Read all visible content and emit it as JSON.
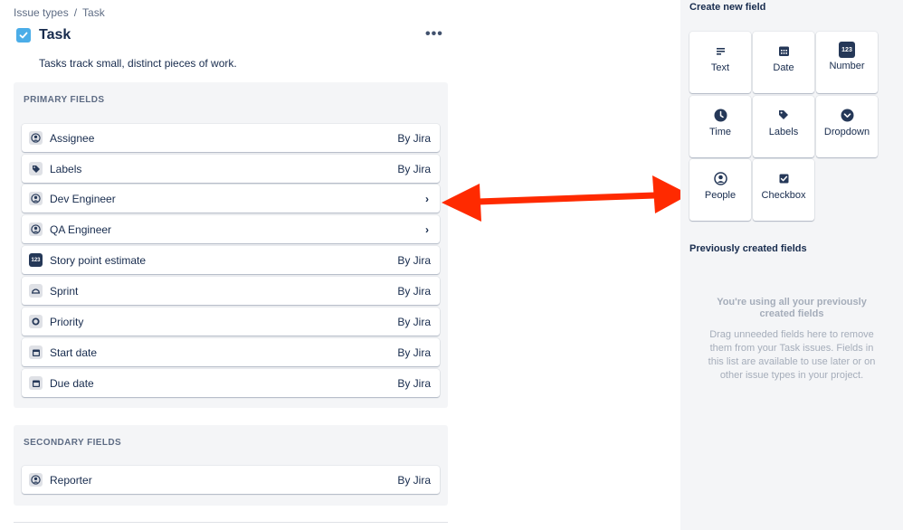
{
  "breadcrumb": {
    "root": "Issue types",
    "separator": "/",
    "current": "Task"
  },
  "header": {
    "title": "Task",
    "more_label": "•••"
  },
  "description": "Tasks track small, distinct pieces of work.",
  "primary": {
    "title": "PRIMARY FIELDS",
    "fields": [
      {
        "label": "Assignee",
        "meta": "By Jira",
        "icon": "person-icon"
      },
      {
        "label": "Labels",
        "meta": "By Jira",
        "icon": "tag-icon"
      },
      {
        "label": "Dev Engineer",
        "meta": "›",
        "icon": "person-icon"
      },
      {
        "label": "QA Engineer",
        "meta": "›",
        "icon": "person-icon"
      },
      {
        "label": "Story point estimate",
        "meta": "By Jira",
        "icon": "number-icon",
        "icon_text": "123"
      },
      {
        "label": "Sprint",
        "meta": "By Jira",
        "icon": "sprint-icon"
      },
      {
        "label": "Priority",
        "meta": "By Jira",
        "icon": "priority-icon"
      },
      {
        "label": "Start date",
        "meta": "By Jira",
        "icon": "calendar-icon"
      },
      {
        "label": "Due date",
        "meta": "By Jira",
        "icon": "calendar-icon"
      }
    ]
  },
  "secondary": {
    "title": "SECONDARY FIELDS",
    "fields": [
      {
        "label": "Reporter",
        "meta": "By Jira",
        "icon": "person-icon"
      }
    ]
  },
  "sidebar": {
    "create_title": "Create new field",
    "tiles": [
      {
        "label": "Text",
        "icon": "text-icon"
      },
      {
        "label": "Date",
        "icon": "calendar-icon"
      },
      {
        "label": "Number",
        "icon": "number-icon",
        "icon_text": "123"
      },
      {
        "label": "Time",
        "icon": "clock-icon"
      },
      {
        "label": "Labels",
        "icon": "tag-icon"
      },
      {
        "label": "Dropdown",
        "icon": "dropdown-icon"
      },
      {
        "label": "People",
        "icon": "person-icon"
      },
      {
        "label": "Checkbox",
        "icon": "checkbox-icon"
      }
    ],
    "previous_title": "Previously created fields",
    "empty_title": "You're using all your previously created fields",
    "empty_body": "Drag unneeded fields here to remove them from your Task issues. Fields in this list are available to use later or on other issue types in your project."
  },
  "colors": {
    "accent": "#4bade8",
    "panel": "#f4f5f7",
    "arrow": "#ff2a00",
    "text": "#172b4d",
    "muted": "#5e6c84"
  }
}
